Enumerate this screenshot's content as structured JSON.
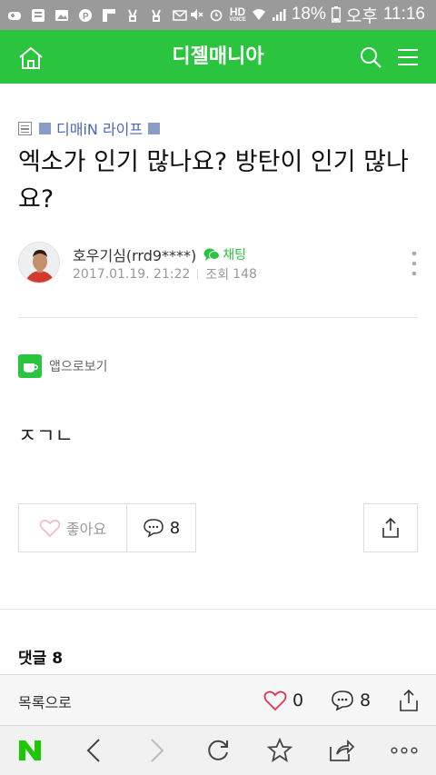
{
  "status_bar": {
    "battery": "18%",
    "ampm": "오후",
    "time": "11:16",
    "hd_label": "HD",
    "voice_label": "VOICE"
  },
  "app_header": {
    "title": "디젤매니아"
  },
  "board": {
    "name": "디매iN 라이프"
  },
  "post": {
    "title": "엑소가 인기 많나요? 방탄이 인기 많나요?",
    "author": "호우기심(rrd9****)",
    "chat_label": "채팅",
    "date": "2017.01.19. 21:22",
    "views_label": "조회",
    "views": "148",
    "app_view_label": "앱으로보기",
    "body": "ㅈㄱㄴ"
  },
  "actions": {
    "like_label": "좋아요",
    "comment_count": "8"
  },
  "comments": {
    "title": "댓글 8"
  },
  "footer": {
    "list_label": "목록으로",
    "like_count": "0",
    "comment_count": "8"
  },
  "colors": {
    "brand_green": "#2bc43f",
    "status_gray": "#9a9a9a",
    "naver_green": "#1ec800",
    "heart_red": "#e0344e"
  }
}
